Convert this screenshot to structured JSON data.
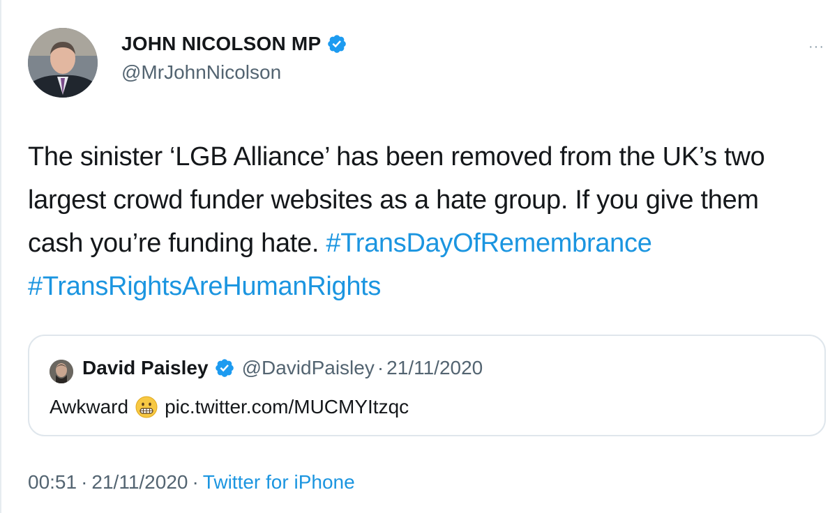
{
  "author": {
    "display_name": "JOHN NICOLSON MP",
    "handle": "@MrJohnNicolson"
  },
  "more_label": "···",
  "tweet": {
    "text": "The sinister ‘LGB Alliance’ has been removed from the UK’s two largest crowd funder websites as a hate group. If you give them cash you’re funding hate.",
    "hashtags": [
      "#TransDayOfRemembrance",
      "#TransRightsAreHumanRights"
    ]
  },
  "quoted": {
    "display_name": "David Paisley",
    "handle": "@DavidPaisley",
    "separator": "·",
    "date": "21/11/2020",
    "text": "Awkward",
    "link": "pic.twitter.com/MUCMYItzqc"
  },
  "meta": {
    "time": "00:51",
    "separator": "·",
    "date": "21/11/2020",
    "source": "Twitter for iPhone"
  },
  "colors": {
    "link": "#1b95e0",
    "verified": "#1d9bf0",
    "secondary_text": "#536471",
    "border": "#dfe6ec"
  },
  "icons": {
    "verified": "verified-badge-icon",
    "emoji": "grimacing-face-emoji",
    "more": "more-options-icon"
  }
}
